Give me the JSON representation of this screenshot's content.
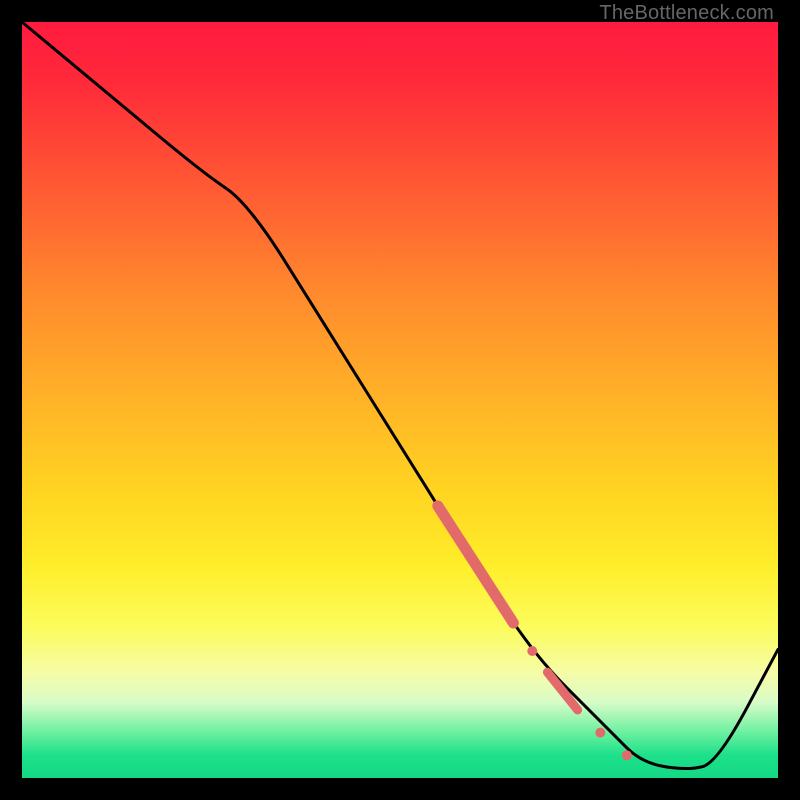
{
  "watermark": "TheBottleneck.com",
  "colors": {
    "curve": "#000000",
    "marker_fill": "#e36a6a",
    "marker_stroke": "#d85c5c"
  },
  "chart_data": {
    "type": "line",
    "title": "",
    "xlabel": "",
    "ylabel": "",
    "xlim": [
      0,
      100
    ],
    "ylim": [
      0,
      100
    ],
    "curve": {
      "x": [
        0,
        12,
        24,
        30,
        40,
        50,
        60,
        66,
        70,
        74,
        78,
        82,
        88,
        92,
        100
      ],
      "y": [
        100,
        90,
        80,
        76,
        60,
        44,
        28,
        19,
        14,
        10,
        6,
        2,
        1,
        2,
        17
      ]
    },
    "markers": [
      {
        "kind": "segment",
        "x0": 55.0,
        "y0": 36.0,
        "x1": 65.0,
        "y1": 20.5,
        "width": 11
      },
      {
        "kind": "dot",
        "x": 67.5,
        "y": 16.8,
        "r": 5
      },
      {
        "kind": "segment",
        "x0": 69.5,
        "y0": 14.0,
        "x1": 73.5,
        "y1": 9.0,
        "width": 9
      },
      {
        "kind": "dot",
        "x": 76.5,
        "y": 6.0,
        "r": 5
      },
      {
        "kind": "dot",
        "x": 80.0,
        "y": 3.0,
        "r": 5
      }
    ]
  }
}
